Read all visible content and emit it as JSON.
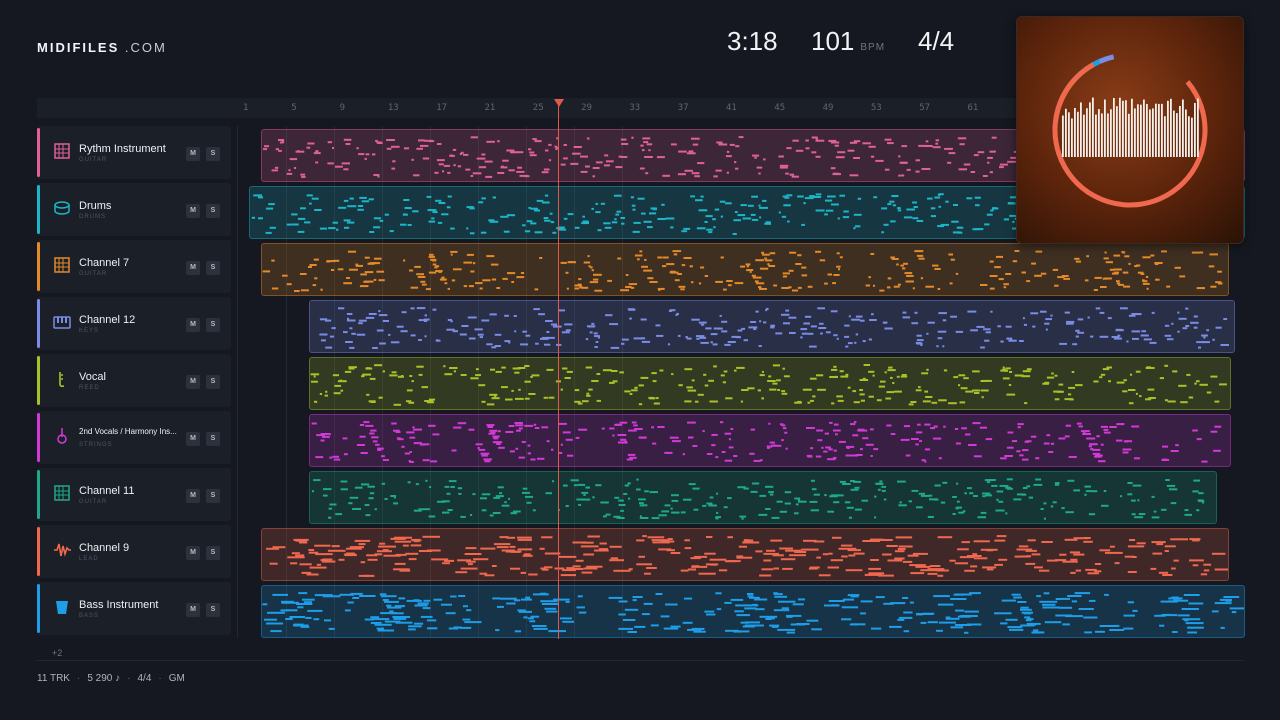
{
  "brand": {
    "name": "MIDIFILES",
    "suffix": ".COM"
  },
  "transport": {
    "time": "3:18",
    "tempo": "101",
    "tempo_unit": "BPM",
    "time_signature": "4/4"
  },
  "ruler": {
    "ticks": [
      "1",
      "5",
      "9",
      "13",
      "17",
      "21",
      "25",
      "29",
      "33",
      "37",
      "41",
      "45",
      "49",
      "53",
      "57",
      "61"
    ]
  },
  "playhead_bar": 27,
  "tracks": [
    {
      "name": "Rythm Instrument",
      "type": "GUITAR",
      "color": "#e0609a",
      "icon": "guitar-fret-icon",
      "mute": "M",
      "solo": "S"
    },
    {
      "name": "Drums",
      "type": "DRUMS",
      "color": "#1cb6c8",
      "icon": "drum-icon",
      "mute": "M",
      "solo": "S"
    },
    {
      "name": "Channel 7",
      "type": "GUITAR",
      "color": "#e58a2a",
      "icon": "guitar-fret-icon",
      "mute": "M",
      "solo": "S"
    },
    {
      "name": "Channel 12",
      "type": "KEYS",
      "color": "#7b8ce6",
      "icon": "keyboard-icon",
      "mute": "M",
      "solo": "S"
    },
    {
      "name": "Vocal",
      "type": "REED",
      "color": "#a8c22a",
      "icon": "reed-icon",
      "mute": "M",
      "solo": "S"
    },
    {
      "name": "2nd Vocals / Harmony Ins...",
      "type": "STRINGS",
      "color": "#d23ad8",
      "icon": "violin-icon",
      "mute": "M",
      "solo": "S"
    },
    {
      "name": "Channel 11",
      "type": "GUITAR",
      "color": "#1fa88a",
      "icon": "guitar-fret-icon",
      "mute": "M",
      "solo": "S"
    },
    {
      "name": "Channel 9",
      "type": "LEAD",
      "color": "#f0684e",
      "icon": "waveform-icon",
      "mute": "M",
      "solo": "S"
    },
    {
      "name": "Bass Instrument",
      "type": "BASS",
      "color": "#1e9ee8",
      "icon": "bass-icon",
      "mute": "M",
      "solo": "S"
    }
  ],
  "more_tracks": "+2",
  "footer": {
    "tracks": "11 TRK",
    "notes": "5 290 ♪",
    "time_signature": "4/4",
    "standard": "GM"
  },
  "cover": {
    "ring_colors": [
      "#e0609a",
      "#e58a2a",
      "#a8c22a",
      "#1fa88a",
      "#1e9ee8",
      "#7b8ce6"
    ],
    "accent": "#f0684e"
  }
}
